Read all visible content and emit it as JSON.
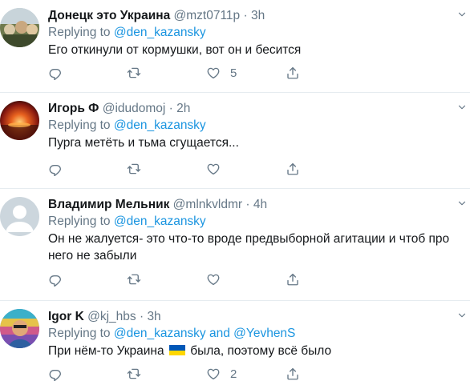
{
  "tweets": [
    {
      "name": "Донецк это Украина",
      "handle": "@mzt0711p",
      "separator": "·",
      "time": "3h",
      "replying_prefix": "Replying to ",
      "mention_1": "@den_kazansky",
      "text": "Его откинули от кормушки, вот он и бесится",
      "likes": "5"
    },
    {
      "name": "Игорь Ф",
      "handle": "@idudomoj",
      "separator": "·",
      "time": "2h",
      "replying_prefix": "Replying to ",
      "mention_1": "@den_kazansky",
      "text": "Пурга метёть и тьма сгущается..."
    },
    {
      "name": "Владимир Мельник",
      "handle": "@mlnkvldmr",
      "separator": "·",
      "time": "4h",
      "replying_prefix": "Replying to ",
      "mention_1": "@den_kazansky",
      "text": "Он не жалуется- это что-то вроде предвыборной агитации и чтоб про него не забыли"
    },
    {
      "name": "Igor K",
      "handle": "@kj_hbs",
      "separator": "·",
      "time": "3h",
      "replying_prefix": "Replying to ",
      "mention_1": "@den_kazansky",
      "mention_joiner": " and ",
      "mention_2": "@YevhenS",
      "text_before": "При нём-то Украина",
      "text_after": "была, поэтому всё было",
      "likes": "2"
    }
  ],
  "colors": {
    "accent": "#1b95e0",
    "muted": "#657786",
    "text": "#14171a",
    "divider": "#e6ecf0",
    "flag_blue": "#0057b7",
    "flag_yellow": "#ffd700"
  },
  "icons": [
    "reply-icon",
    "retweet-icon",
    "like-icon",
    "share-icon",
    "chevron-down-icon",
    "ukraine-flag-icon"
  ]
}
